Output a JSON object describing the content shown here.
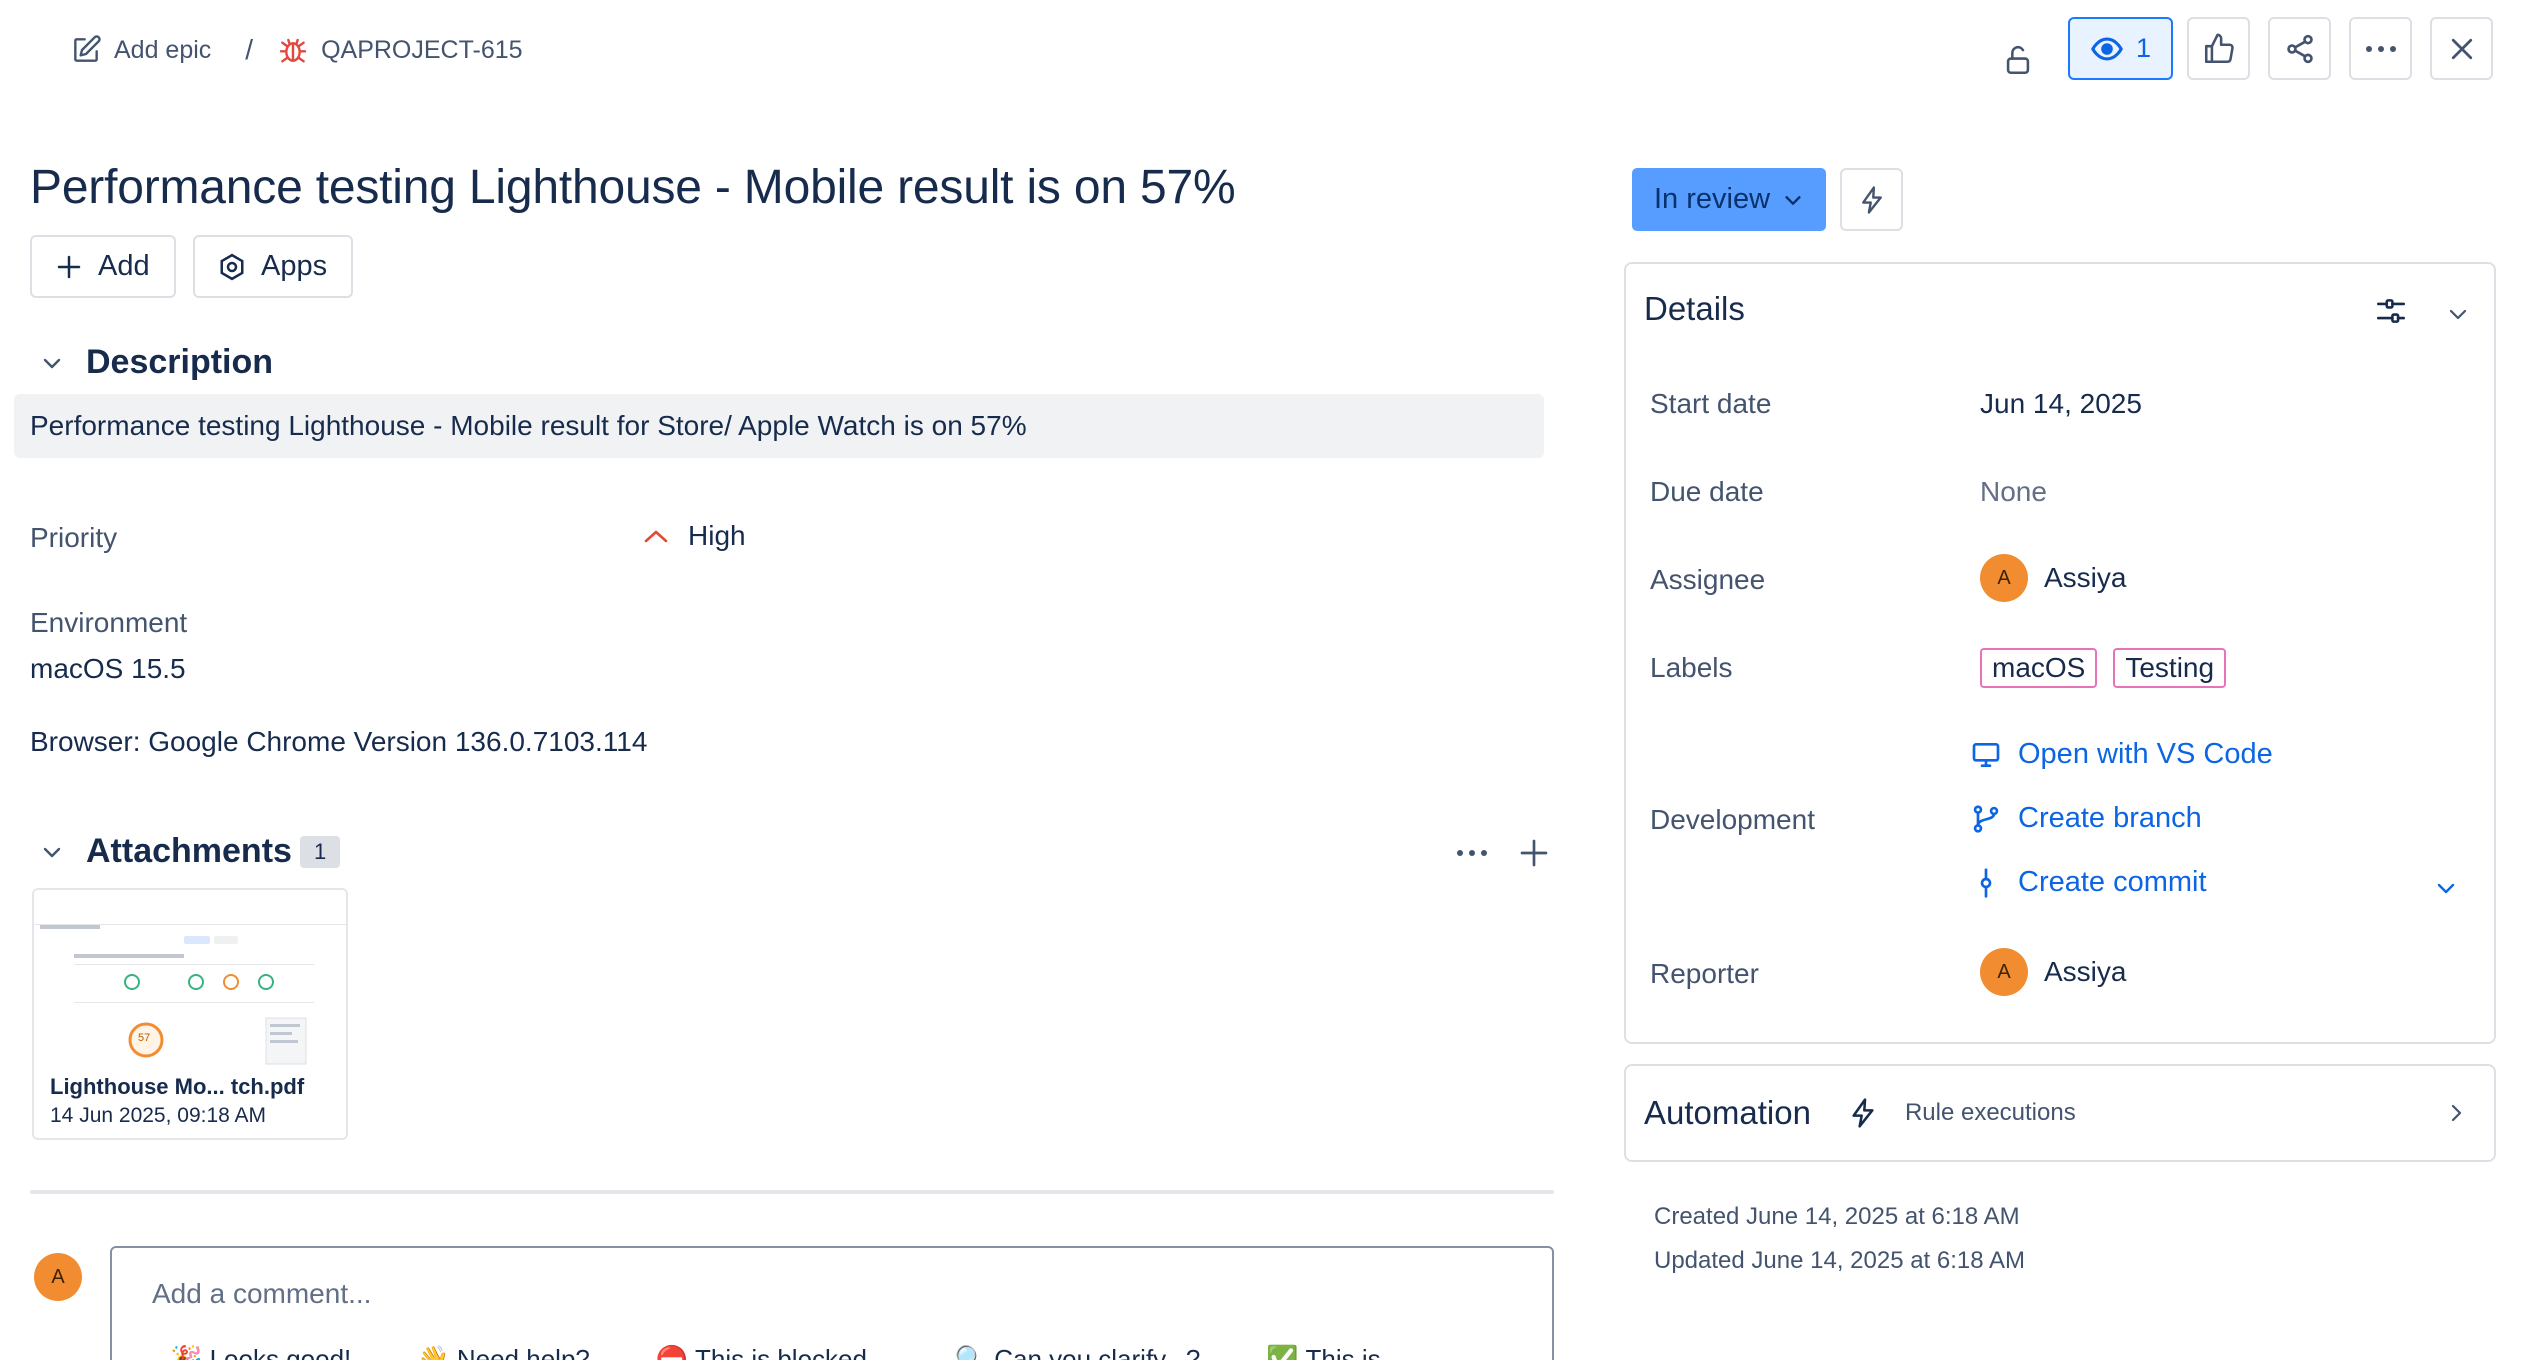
{
  "breadcrumb": {
    "add_epic": "Add epic",
    "separator": "/",
    "issue_key": "QAPROJECT-615"
  },
  "toolbar": {
    "watch_count": "1"
  },
  "issue": {
    "title": "Performance testing Lighthouse - Mobile result is on 57%",
    "add_label": "Add",
    "apps_label": "Apps"
  },
  "description": {
    "heading": "Description",
    "text": "Performance testing Lighthouse - Mobile result for Store/ Apple Watch is on 57%"
  },
  "fields": {
    "priority_label": "Priority",
    "priority_value": "High",
    "environment_label": "Environment",
    "environment_line1": "macOS 15.5",
    "environment_line2": "Browser: Google Chrome Version 136.0.7103.114"
  },
  "attachments": {
    "heading": "Attachments",
    "count": "1",
    "file_name": "Lighthouse Mo... tch.pdf",
    "file_date": "14 Jun 2025, 09:18 AM",
    "thumb_score": "57"
  },
  "comment": {
    "avatar_initial": "A",
    "placeholder": "Add a comment...",
    "quick_replies": [
      "🎉 Looks good!",
      "👋 Need help?",
      "⛔ This is blocked...",
      "🔍 Can you clarify...?",
      "✅ This is..."
    ]
  },
  "status": {
    "label": "In review"
  },
  "details": {
    "heading": "Details",
    "start_date_label": "Start date",
    "start_date_value": "Jun 14, 2025",
    "due_date_label": "Due date",
    "due_date_value": "None",
    "assignee_label": "Assignee",
    "assignee_initial": "A",
    "assignee_name": "Assiya",
    "labels_label": "Labels",
    "labels": [
      "macOS",
      "Testing"
    ],
    "development_label": "Development",
    "open_vscode": "Open with VS Code",
    "create_branch": "Create branch",
    "create_commit": "Create commit",
    "reporter_label": "Reporter",
    "reporter_initial": "A",
    "reporter_name": "Assiya"
  },
  "automation": {
    "heading": "Automation",
    "rule_executions": "Rule executions"
  },
  "meta": {
    "created": "Created June 14, 2025 at 6:18 AM",
    "updated": "Updated June 14, 2025 at 6:18 AM"
  },
  "colors": {
    "accent_blue": "#0c66e4",
    "status_bg": "#579dff",
    "priority_high": "#e34935",
    "avatar_orange": "#f18d30",
    "label_border": "#e774bb",
    "bug_red": "#e2483d"
  }
}
